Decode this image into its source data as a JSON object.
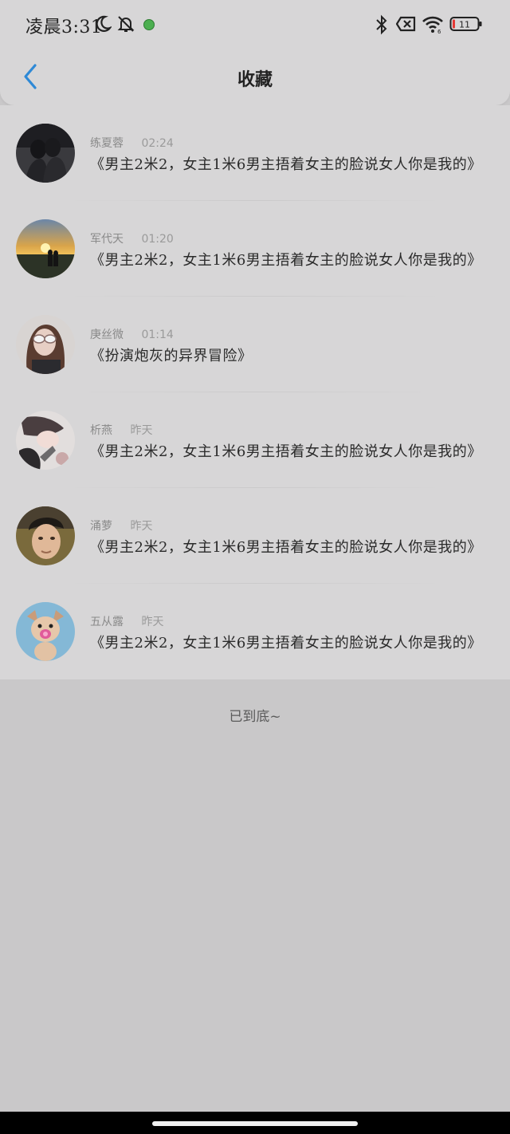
{
  "status_bar": {
    "time": "凌晨3:31",
    "battery_level": "11"
  },
  "header": {
    "title": "收藏",
    "back_icon": "chevron-left-icon",
    "accent_color": "#2e89d6"
  },
  "items": [
    {
      "name": "练夏蓉",
      "time": "02:24",
      "title": "《男主2米2，女主1米6男主捂着女主的脸说女人你是我的》",
      "avatar": "couple-silhouette"
    },
    {
      "name": "军代天",
      "time": "01:20",
      "title": "《男主2米2，女主1米6男主捂着女主的脸说女人你是我的》",
      "avatar": "sunset-couple"
    },
    {
      "name": "庚丝微",
      "time": "01:14",
      "title": "《扮演炮灰的异界冒险》",
      "avatar": "girl-sunglasses"
    },
    {
      "name": "析燕",
      "time": "昨天",
      "title": "《男主2米2，女主1米6男主捂着女主的脸说女人你是我的》",
      "avatar": "anime-girl"
    },
    {
      "name": "涌萝",
      "time": "昨天",
      "title": "《男主2米2，女主1米6男主捂着女主的脸说女人你是我的》",
      "avatar": "man-portrait"
    },
    {
      "name": "五从露",
      "time": "昨天",
      "title": "《男主2米2，女主1米6男主捂着女主的脸说女人你是我的》",
      "avatar": "puppy-pacifier"
    }
  ],
  "footer": {
    "end_text": "已到底~"
  }
}
